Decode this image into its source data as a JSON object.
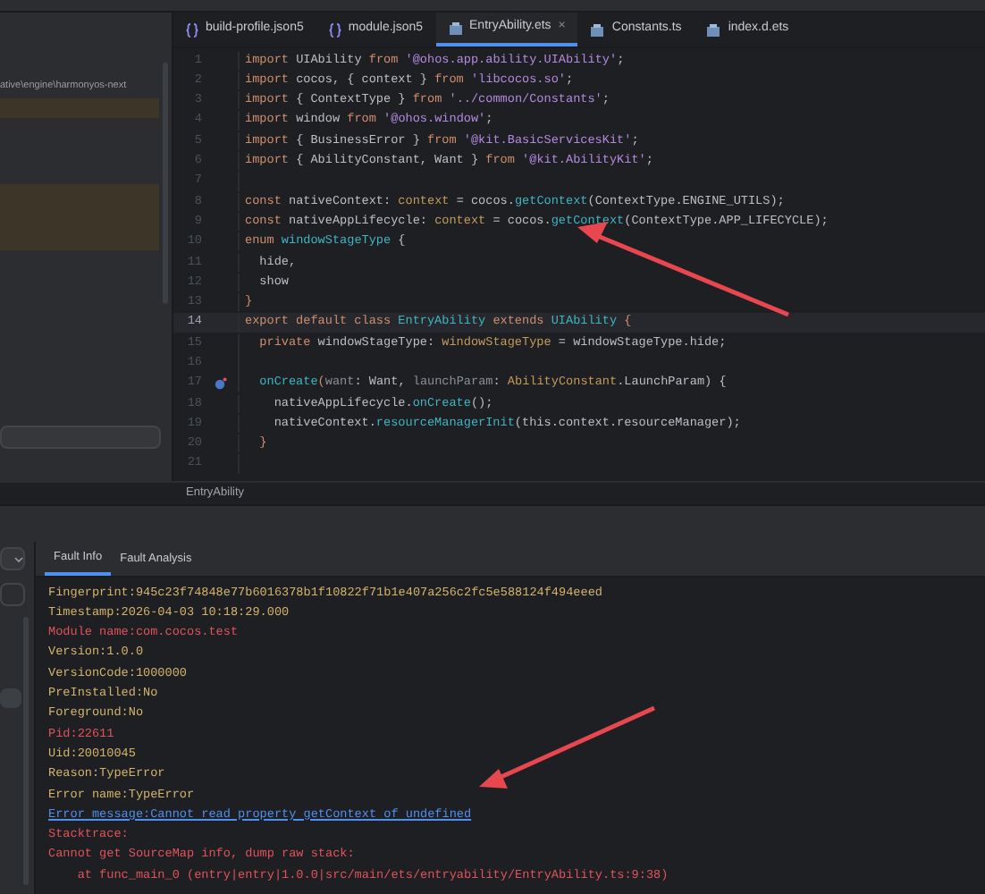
{
  "project_panel": {
    "path": "ative\\engine\\harmonyos-next"
  },
  "editor": {
    "tabs": [
      {
        "label": "build-profile.json5",
        "selected": false,
        "kind": "json"
      },
      {
        "label": "module.json5",
        "selected": false,
        "kind": "json"
      },
      {
        "label": "EntryAbility.ets",
        "selected": true,
        "kind": "ets"
      },
      {
        "label": "Constants.ts",
        "selected": false,
        "kind": "ets"
      },
      {
        "label": "index.d.ets",
        "selected": false,
        "kind": "ets"
      }
    ],
    "close_glyph": "×",
    "lines": [
      {
        "number": "1",
        "current": false,
        "marker": false,
        "tokens": [
          {
            "text": "import",
            "kind": "keyword"
          },
          {
            "text": " UIAbility ",
            "kind": "plain"
          },
          {
            "text": "from",
            "kind": "keyword"
          },
          {
            "text": " '@ohos.app.ability.UIAbility'",
            "kind": "string"
          },
          {
            "text": ";",
            "kind": "plain"
          }
        ]
      },
      {
        "number": "2",
        "current": false,
        "marker": false,
        "tokens": [
          {
            "text": "import",
            "kind": "keyword"
          },
          {
            "text": " cocos, { context } ",
            "kind": "plain"
          },
          {
            "text": "from",
            "kind": "keyword"
          },
          {
            "text": " 'libcocos.so'",
            "kind": "string"
          },
          {
            "text": ";",
            "kind": "plain"
          }
        ]
      },
      {
        "number": "3",
        "current": false,
        "marker": false,
        "tokens": [
          {
            "text": "import",
            "kind": "keyword"
          },
          {
            "text": " { ContextType } ",
            "kind": "plain"
          },
          {
            "text": "from",
            "kind": "keyword"
          },
          {
            "text": " '../common/Constants'",
            "kind": "string"
          },
          {
            "text": ";",
            "kind": "plain"
          }
        ]
      },
      {
        "number": "4",
        "current": false,
        "marker": false,
        "tokens": [
          {
            "text": "import",
            "kind": "keyword"
          },
          {
            "text": " window ",
            "kind": "plain"
          },
          {
            "text": "from",
            "kind": "keyword"
          },
          {
            "text": " '@ohos.window'",
            "kind": "string"
          },
          {
            "text": ";",
            "kind": "plain"
          }
        ]
      },
      {
        "number": "5",
        "current": false,
        "marker": false,
        "tokens": [
          {
            "text": "import",
            "kind": "keyword"
          },
          {
            "text": " { BusinessError } ",
            "kind": "plain"
          },
          {
            "text": "from",
            "kind": "keyword"
          },
          {
            "text": " '@kit.BasicServicesKit'",
            "kind": "string"
          },
          {
            "text": ";",
            "kind": "plain"
          }
        ]
      },
      {
        "number": "6",
        "current": false,
        "marker": false,
        "tokens": [
          {
            "text": "import",
            "kind": "keyword"
          },
          {
            "text": " { AbilityConstant, Want } ",
            "kind": "plain"
          },
          {
            "text": "from",
            "kind": "keyword"
          },
          {
            "text": " '@kit.AbilityKit'",
            "kind": "string"
          },
          {
            "text": ";",
            "kind": "plain"
          }
        ]
      },
      {
        "number": "7",
        "current": false,
        "marker": false
      },
      {
        "number": "8",
        "current": false,
        "marker": false,
        "tokens": [
          {
            "text": "const",
            "kind": "keyword"
          },
          {
            "text": " nativeContext: ",
            "kind": "plain"
          },
          {
            "text": "context",
            "kind": "type"
          },
          {
            "text": " = cocos.",
            "kind": "plain"
          },
          {
            "text": "getContext",
            "kind": "function"
          },
          {
            "text": "(ContextType.ENGINE_UTILS);",
            "kind": "plain"
          }
        ]
      },
      {
        "number": "9",
        "current": false,
        "marker": false,
        "tokens": [
          {
            "text": "const",
            "kind": "keyword"
          },
          {
            "text": " nativeAppLifecycle: ",
            "kind": "plain"
          },
          {
            "text": "context",
            "kind": "type"
          },
          {
            "text": " = cocos.",
            "kind": "plain"
          },
          {
            "text": "getContext",
            "kind": "function"
          },
          {
            "text": "(ContextType.APP_LIFECYCLE);",
            "kind": "plain"
          }
        ]
      },
      {
        "number": "10",
        "current": false,
        "marker": false,
        "tokens": [
          {
            "text": "enum",
            "kind": "keyword"
          },
          {
            "text": " windowStageType",
            "kind": "function"
          },
          {
            "text": " {",
            "kind": "plain"
          }
        ]
      },
      {
        "number": "11",
        "current": false,
        "marker": false,
        "tokens": [
          {
            "text": "  hide,",
            "kind": "plain"
          }
        ]
      },
      {
        "number": "12",
        "current": false,
        "marker": false,
        "tokens": [
          {
            "text": "  show",
            "kind": "plain"
          }
        ]
      },
      {
        "number": "13",
        "current": false,
        "marker": false,
        "tokens": [
          {
            "text": "}",
            "kind": "keyword"
          }
        ]
      },
      {
        "number": "14",
        "current": true,
        "marker": false,
        "tokens": [
          {
            "text": "export default class",
            "kind": "keyword"
          },
          {
            "text": " EntryAbility",
            "kind": "function"
          },
          {
            "text": " extends",
            "kind": "keyword"
          },
          {
            "text": " UIAbility",
            "kind": "function"
          },
          {
            "text": " {",
            "kind": "keyword"
          }
        ]
      },
      {
        "number": "15",
        "current": false,
        "marker": false,
        "tokens": [
          {
            "text": "  private",
            "kind": "keyword"
          },
          {
            "text": " windowStageType: ",
            "kind": "plain"
          },
          {
            "text": "windowStageType",
            "kind": "type"
          },
          {
            "text": " = windowStageType.hide;",
            "kind": "plain"
          }
        ]
      },
      {
        "number": "16",
        "current": false,
        "marker": false
      },
      {
        "number": "17",
        "current": false,
        "marker": true,
        "tokens": [
          {
            "text": "  onCreate",
            "kind": "function"
          },
          {
            "text": "(",
            "kind": "keyword"
          },
          {
            "text": "want",
            "kind": "param"
          },
          {
            "text": ": Want, ",
            "kind": "plain"
          },
          {
            "text": "launchParam",
            "kind": "param"
          },
          {
            "text": ": ",
            "kind": "plain"
          },
          {
            "text": "AbilityConstant",
            "kind": "type"
          },
          {
            "text": ".LaunchParam) {",
            "kind": "plain"
          }
        ]
      },
      {
        "number": "18",
        "current": false,
        "marker": false,
        "tokens": [
          {
            "text": "    nativeAppLifecycle.",
            "kind": "plain"
          },
          {
            "text": "onCreate",
            "kind": "function"
          },
          {
            "text": "();",
            "kind": "plain"
          }
        ]
      },
      {
        "number": "19",
        "current": false,
        "marker": false,
        "tokens": [
          {
            "text": "    nativeContext.",
            "kind": "plain"
          },
          {
            "text": "resourceManagerInit",
            "kind": "function"
          },
          {
            "text": "(this.context.resourceManager);",
            "kind": "plain"
          }
        ]
      },
      {
        "number": "20",
        "current": false,
        "marker": false,
        "tokens": [
          {
            "text": "  }",
            "kind": "keyword"
          }
        ]
      },
      {
        "number": "21",
        "current": false,
        "marker": false
      }
    ],
    "breadcrumb": "EntryAbility"
  },
  "fault_panel": {
    "tabs": [
      {
        "label": "Fault Info",
        "selected": true
      },
      {
        "label": "Fault Analysis",
        "selected": false
      }
    ],
    "log": [
      {
        "text": "Fingerprint:945c23f74848e77b6016378b1f10822f71b1e407a256c2fc5e588124f494eeed",
        "kind": "info"
      },
      {
        "text": "Timestamp:2026-04-03 10:18:29.000",
        "kind": "info"
      },
      {
        "text": "Module name:com.cocos.test",
        "kind": "error"
      },
      {
        "text": "Version:1.0.0",
        "kind": "info"
      },
      {
        "text": "VersionCode:1000000",
        "kind": "info"
      },
      {
        "text": "PreInstalled:No",
        "kind": "info"
      },
      {
        "text": "Foreground:No",
        "kind": "info"
      },
      {
        "text": "Pid:22611",
        "kind": "error"
      },
      {
        "text": "Uid:20010045",
        "kind": "info"
      },
      {
        "text": "Reason:TypeError",
        "kind": "info"
      },
      {
        "text": "Error name:TypeError",
        "kind": "info"
      },
      {
        "text": "Error message:Cannot read property getContext of undefined",
        "kind": "link"
      },
      {
        "text": "Stacktrace:",
        "kind": "error"
      },
      {
        "text": "Cannot get SourceMap info, dump raw stack:",
        "kind": "error"
      },
      {
        "text": "    at func_main_0 (entry|entry|1.0.0|src/main/ets/entryability/EntryAbility.ts:9:38)",
        "kind": "error"
      }
    ]
  }
}
